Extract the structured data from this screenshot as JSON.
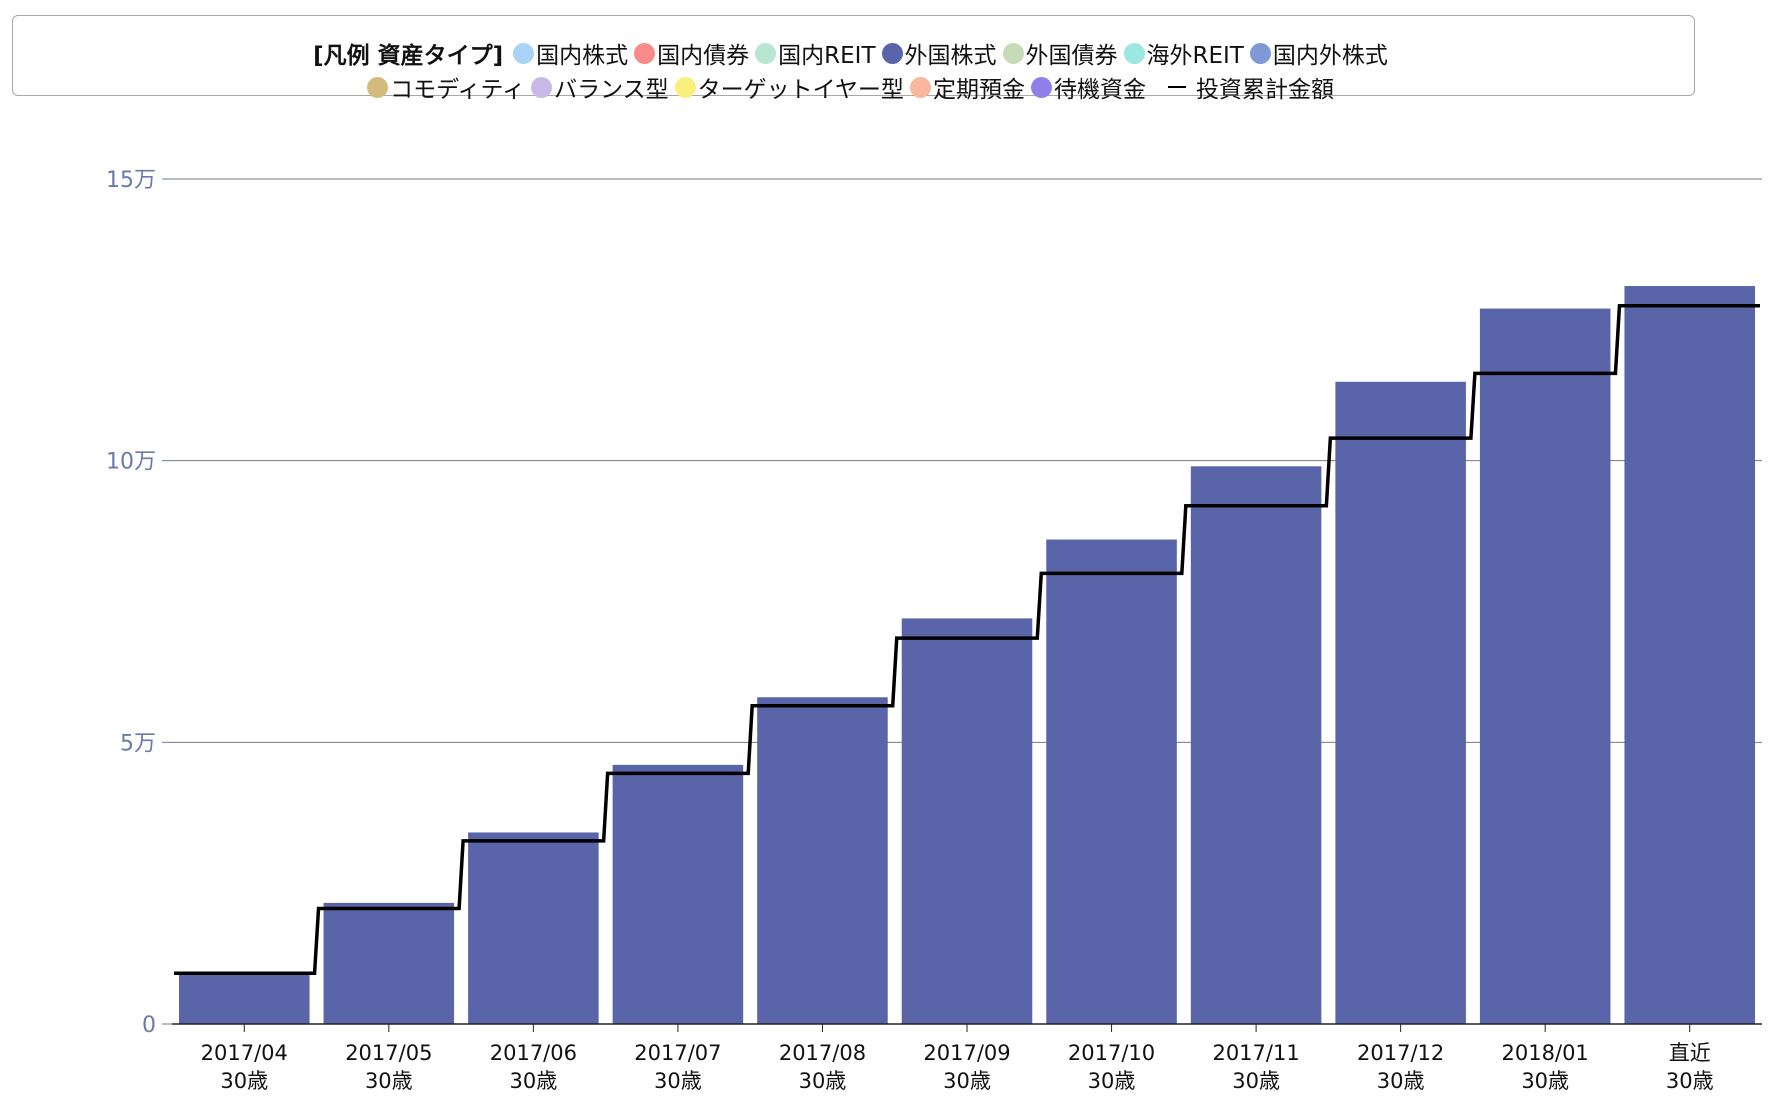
{
  "legend": {
    "title": "[凡例 資産タイプ]",
    "row1": [
      {
        "label": "国内株式",
        "color": "#a9d4f7"
      },
      {
        "label": "国内債券",
        "color": "#f98b8b"
      },
      {
        "label": "国内REIT",
        "color": "#b7e6d2"
      },
      {
        "label": "外国株式",
        "color": "#5965a8"
      },
      {
        "label": "外国債券",
        "color": "#c6dcb8"
      },
      {
        "label": "海外REIT",
        "color": "#9be7e2"
      },
      {
        "label": "国内外株式",
        "color": "#7f99d6"
      }
    ],
    "row2": [
      {
        "label": "コモディティ",
        "color": "#d2bb7d"
      },
      {
        "label": "バランス型",
        "color": "#c9b8e6"
      },
      {
        "label": "ターゲットイヤー型",
        "color": "#f9ef7f"
      },
      {
        "label": "定期預金",
        "color": "#f9b7a0"
      },
      {
        "label": "待機資金",
        "color": "#8f80ea"
      }
    ],
    "line_label": "投資累計金額",
    "line_color": "#000000"
  },
  "chart_data": {
    "type": "bar",
    "categories": [
      "2017/04",
      "2017/05",
      "2017/06",
      "2017/07",
      "2017/08",
      "2017/09",
      "2017/10",
      "2017/11",
      "2017/12",
      "2018/01",
      "直近"
    ],
    "category_sublabels": [
      "30歳",
      "30歳",
      "30歳",
      "30歳",
      "30歳",
      "30歳",
      "30歳",
      "30歳",
      "30歳",
      "30歳",
      "30歳"
    ],
    "series": [
      {
        "name": "外国株式",
        "type": "bar",
        "color": "#5965a8",
        "values": [
          9000,
          21500,
          34000,
          46000,
          58000,
          72000,
          86000,
          99000,
          114000,
          127000,
          131000
        ]
      },
      {
        "name": "投資累計金額",
        "type": "step-line",
        "color": "#000000",
        "values": [
          9000,
          20500,
          32500,
          44500,
          56500,
          68500,
          80000,
          92000,
          104000,
          115500,
          127500
        ]
      }
    ],
    "ylim": [
      0,
      150000
    ],
    "yticks": [
      {
        "value": 0,
        "label": "0"
      },
      {
        "value": 50000,
        "label": "5万"
      },
      {
        "value": 100000,
        "label": "10万"
      },
      {
        "value": 150000,
        "label": "15万"
      }
    ],
    "grid": true,
    "legend_position": "top",
    "axis_color": "#6a7aaa",
    "grid_color": "#7a7a7a"
  }
}
